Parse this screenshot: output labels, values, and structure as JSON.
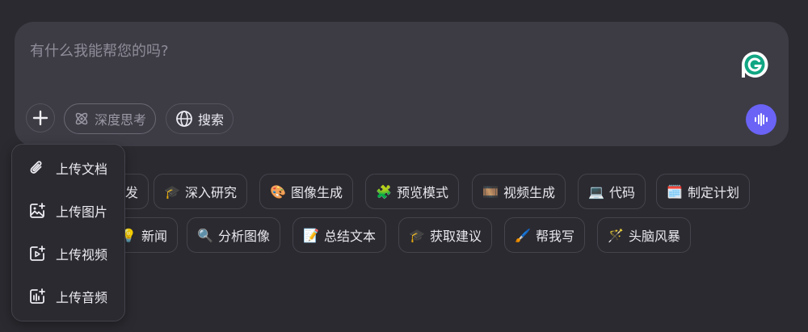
{
  "composer": {
    "placeholder": "有什么我能帮您的吗?",
    "deep_think_label": "深度思考",
    "search_label": "搜索"
  },
  "suggestions_row1": [
    {
      "emoji": "",
      "label": "发"
    },
    {
      "emoji": "🎓",
      "label": "深入研究"
    },
    {
      "emoji": "🎨",
      "label": "图像生成"
    },
    {
      "emoji": "🧩",
      "label": "预览模式"
    },
    {
      "emoji": "🎞️",
      "label": "视频生成"
    },
    {
      "emoji": "💻",
      "label": "代码"
    },
    {
      "emoji": "🗓️",
      "label": "制定计划"
    }
  ],
  "suggestions_row2": [
    {
      "emoji": "💡",
      "label": "新闻"
    },
    {
      "emoji": "🔍",
      "label": "分析图像"
    },
    {
      "emoji": "📝",
      "label": "总结文本"
    },
    {
      "emoji": "🎓",
      "label": "获取建议"
    },
    {
      "emoji": "🖌️",
      "label": "帮我写"
    },
    {
      "emoji": "🪄",
      "label": "头脑风暴"
    }
  ],
  "upload_menu": [
    {
      "icon": "paperclip-icon",
      "label": "上传文档"
    },
    {
      "icon": "image-upload-icon",
      "label": "上传图片"
    },
    {
      "icon": "video-upload-icon",
      "label": "上传视频"
    },
    {
      "icon": "audio-upload-icon",
      "label": "上传音频"
    }
  ],
  "colors": {
    "accent": "#6a63f6",
    "background": "#2b2a30",
    "composer": "#3d3c45"
  }
}
